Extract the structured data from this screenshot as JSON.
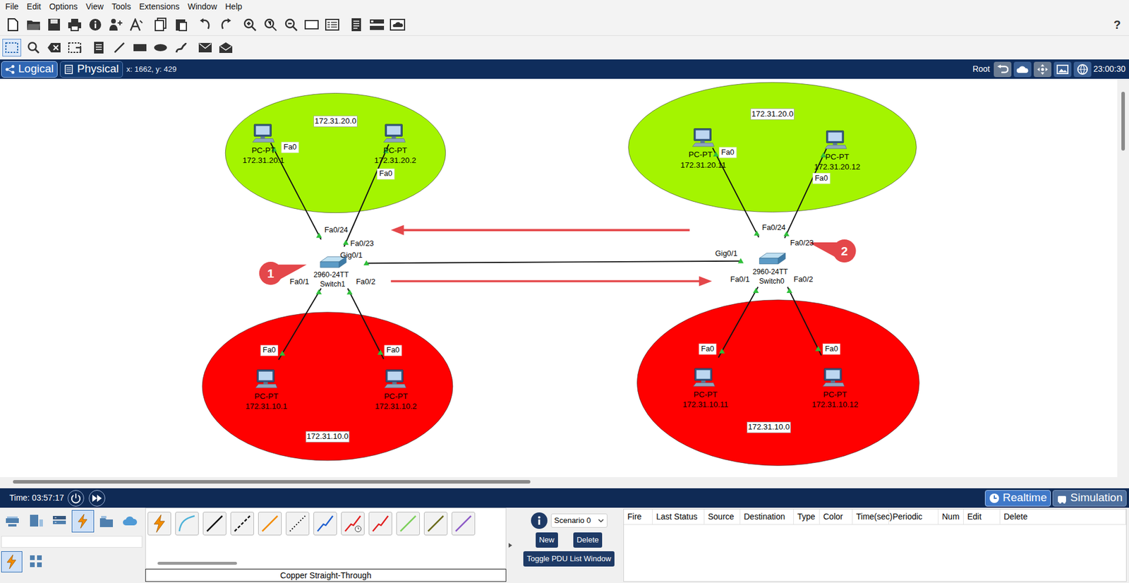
{
  "menu": [
    "File",
    "Edit",
    "Options",
    "View",
    "Tools",
    "Extensions",
    "Window",
    "Help"
  ],
  "help": "?",
  "view_tabs": [
    {
      "label": "Logical",
      "selected": true
    },
    {
      "label": "Physical",
      "selected": false
    }
  ],
  "cursor_coords": "x: 1662, y: 429",
  "workspace": {
    "label": "Root",
    "clock": "23:00:30"
  },
  "diagram": {
    "networks": [
      {
        "label": "172.31.20.0",
        "color": "#a4f400"
      },
      {
        "label": "172.31.10.0",
        "color": "#ff0000"
      },
      {
        "label": "172.31.20.0",
        "color": "#a4f400"
      },
      {
        "label": "172.31.10.0",
        "color": "#ff0000"
      }
    ],
    "switches": [
      {
        "model": "2960-24TT",
        "name": "Switch1",
        "callout": "1",
        "uplink": "Gig0/1"
      },
      {
        "model": "2960-24TT",
        "name": "Switch0",
        "callout": "2",
        "uplink": "Gig0/1"
      }
    ],
    "pcs": [
      {
        "name": "PC-PT",
        "ip": "172.31.20.1",
        "port": "Fa0",
        "switch_port": "Fa0/24"
      },
      {
        "name": "PC-PT",
        "ip": "172.31.20.2",
        "port": "Fa0",
        "switch_port": "Fa0/23"
      },
      {
        "name": "PC-PT",
        "ip": "172.31.10.1",
        "port": "Fa0",
        "switch_port": "Fa0/1"
      },
      {
        "name": "PC-PT",
        "ip": "172.31.10.2",
        "port": "Fa0",
        "switch_port": "Fa0/2"
      },
      {
        "name": "PC-PT",
        "ip": "172.31.20.11",
        "port": "Fa0",
        "switch_port": "Fa0/24"
      },
      {
        "name": "PC-PT",
        "ip": "172.31.20.12",
        "port": "Fa0",
        "switch_port": "Fa0/23"
      },
      {
        "name": "PC-PT",
        "ip": "172.31.10.11",
        "port": "Fa0",
        "switch_port": "Fa0/1"
      },
      {
        "name": "PC-PT",
        "ip": "172.31.10.12",
        "port": "Fa0",
        "switch_port": "Fa0/2"
      }
    ]
  },
  "time_bar": {
    "time": "Time: 03:57:17",
    "modes": [
      {
        "label": "Realtime",
        "selected": true
      },
      {
        "label": "Simulation",
        "selected": false
      }
    ]
  },
  "bottom": {
    "device_categories": [
      {
        "selected": false
      },
      {
        "selected": false
      },
      {
        "selected": false
      },
      {
        "selected": true
      },
      {
        "selected": false
      },
      {
        "selected": false
      }
    ],
    "device_subtypes": [
      {
        "selected": true
      },
      {
        "selected": false
      }
    ],
    "cable_label": "Copper Straight-Through",
    "pdu": {
      "scenario": "Scenario 0",
      "buttons": [
        "New",
        "Delete"
      ],
      "toggle": "Toggle PDU List Window",
      "columns": [
        "Fire",
        "Last Status",
        "Source",
        "Destination",
        "Type",
        "Color",
        "Time(sec)",
        "Periodic",
        "Num",
        "Edit",
        "Delete"
      ]
    }
  }
}
